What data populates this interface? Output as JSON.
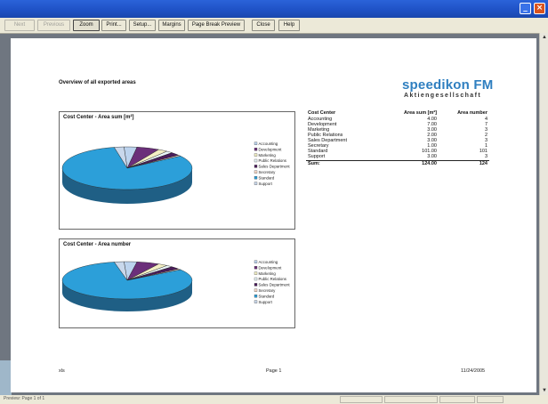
{
  "toolbar": {
    "buttons": [
      {
        "label": "Next",
        "state": "disabled"
      },
      {
        "label": "Previous",
        "state": "disabled"
      },
      {
        "label": "Zoom",
        "state": "pressed"
      },
      {
        "label": "Print...",
        "state": "normal"
      },
      {
        "label": "Setup...",
        "state": "normal"
      },
      {
        "label": "Margins",
        "state": "normal"
      },
      {
        "label": "Page Break Preview",
        "state": "normal"
      },
      {
        "label": "Close",
        "state": "normal"
      },
      {
        "label": "Help",
        "state": "normal"
      }
    ]
  },
  "window_controls": {
    "minimize": "_",
    "close": "×"
  },
  "report": {
    "heading": "Overview of all exported areas",
    "logo_name": "speedikon FM",
    "logo_sub": "Aktiengesellschaft",
    "footer_left": "xls",
    "footer_center": "Page 1",
    "footer_right": "11/24/2005"
  },
  "table": {
    "headers": [
      "Cost Center",
      "Area sum [m²]",
      "Area number"
    ],
    "rows": [
      [
        "Accounting",
        "4.00",
        "4"
      ],
      [
        "Development",
        "7.00",
        "7"
      ],
      [
        "Marketing",
        "3.00",
        "3"
      ],
      [
        "Public Relations",
        "2.00",
        "2"
      ],
      [
        "Sales Department",
        "3.00",
        "3"
      ],
      [
        "Secretary",
        "1.00",
        "1"
      ],
      [
        "Standard",
        "101.00",
        "101"
      ],
      [
        "Support",
        "3.00",
        "3"
      ]
    ],
    "sum": [
      "Sum:",
      "124.00",
      "124"
    ]
  },
  "colors": {
    "titlebar": "#1f52c6",
    "logo": "#2f7fc0",
    "slices": [
      "#bcd3ee",
      "#6b2f7a",
      "#f3efc4",
      "#eaf6f8",
      "#4a1d5a",
      "#f7d9c8",
      "#3b7fb0",
      "#c9d8ec"
    ],
    "standard_top": "#2c9fd9",
    "standard_side": "#1f5f85"
  },
  "chart_data": [
    {
      "type": "pie",
      "title": "Cost Center - Area sum [m²]",
      "categories": [
        "Accounting",
        "Development",
        "Marketing",
        "Public Relations",
        "Sales Department",
        "Secretary",
        "Standard",
        "Support"
      ],
      "values": [
        4,
        7,
        3,
        2,
        3,
        1,
        101,
        3
      ],
      "legend": "right"
    },
    {
      "type": "pie",
      "title": "Cost Center - Area number",
      "categories": [
        "Accounting",
        "Development",
        "Marketing",
        "Public Relations",
        "Sales Department",
        "Secretary",
        "Standard",
        "Support"
      ],
      "values": [
        4,
        7,
        3,
        2,
        3,
        1,
        101,
        3
      ],
      "legend": "right"
    }
  ],
  "status": {
    "text": "Preview: Page 1 of 1"
  }
}
